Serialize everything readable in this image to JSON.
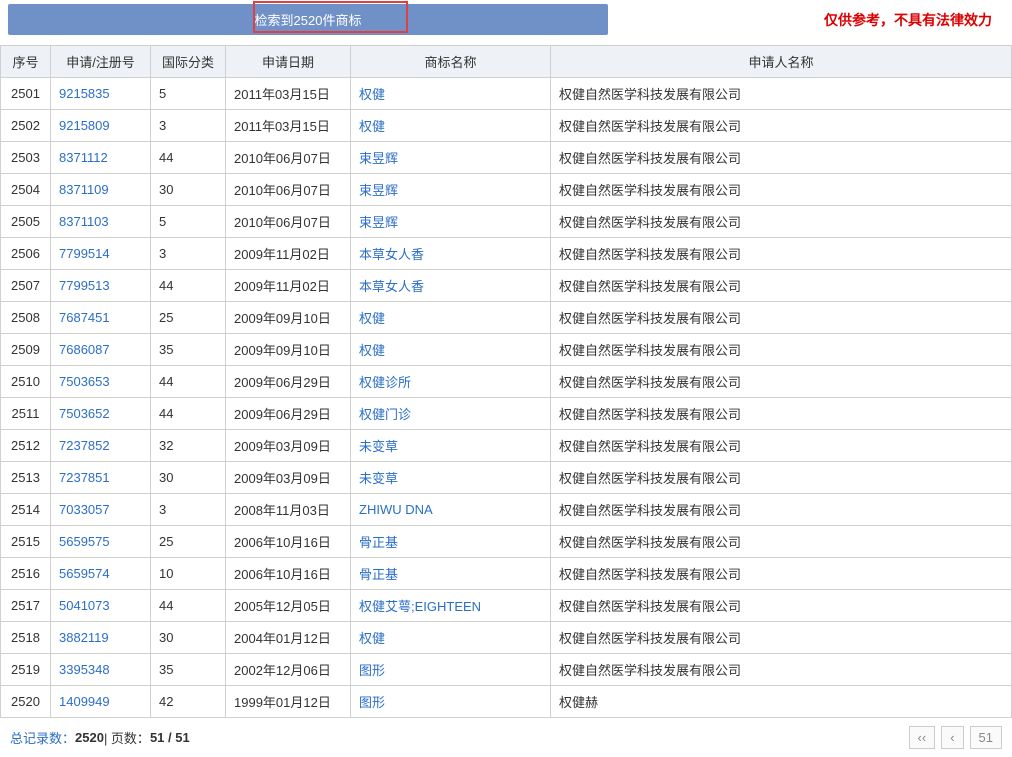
{
  "header": {
    "title": "检索到2520件商标",
    "disclaimer": "仅供参考，不具有法律效力"
  },
  "columns": [
    "序号",
    "申请/注册号",
    "国际分类",
    "申请日期",
    "商标名称",
    "申请人名称"
  ],
  "rows": [
    {
      "seq": "2501",
      "regno": "9215835",
      "cls": "5",
      "date": "2011年03月15日",
      "name": "权健",
      "applicant": "权健自然医学科技发展有限公司"
    },
    {
      "seq": "2502",
      "regno": "9215809",
      "cls": "3",
      "date": "2011年03月15日",
      "name": "权健",
      "applicant": "权健自然医学科技发展有限公司"
    },
    {
      "seq": "2503",
      "regno": "8371112",
      "cls": "44",
      "date": "2010年06月07日",
      "name": "束昱辉",
      "applicant": "权健自然医学科技发展有限公司"
    },
    {
      "seq": "2504",
      "regno": "8371109",
      "cls": "30",
      "date": "2010年06月07日",
      "name": "束昱辉",
      "applicant": "权健自然医学科技发展有限公司"
    },
    {
      "seq": "2505",
      "regno": "8371103",
      "cls": "5",
      "date": "2010年06月07日",
      "name": "束昱辉",
      "applicant": "权健自然医学科技发展有限公司"
    },
    {
      "seq": "2506",
      "regno": "7799514",
      "cls": "3",
      "date": "2009年11月02日",
      "name": "本草女人香",
      "applicant": "权健自然医学科技发展有限公司"
    },
    {
      "seq": "2507",
      "regno": "7799513",
      "cls": "44",
      "date": "2009年11月02日",
      "name": "本草女人香",
      "applicant": "权健自然医学科技发展有限公司"
    },
    {
      "seq": "2508",
      "regno": "7687451",
      "cls": "25",
      "date": "2009年09月10日",
      "name": "权健",
      "applicant": "权健自然医学科技发展有限公司"
    },
    {
      "seq": "2509",
      "regno": "7686087",
      "cls": "35",
      "date": "2009年09月10日",
      "name": "权健",
      "applicant": "权健自然医学科技发展有限公司"
    },
    {
      "seq": "2510",
      "regno": "7503653",
      "cls": "44",
      "date": "2009年06月29日",
      "name": "权健诊所",
      "applicant": "权健自然医学科技发展有限公司"
    },
    {
      "seq": "2511",
      "regno": "7503652",
      "cls": "44",
      "date": "2009年06月29日",
      "name": "权健门诊",
      "applicant": "权健自然医学科技发展有限公司"
    },
    {
      "seq": "2512",
      "regno": "7237852",
      "cls": "32",
      "date": "2009年03月09日",
      "name": "未变草",
      "applicant": "权健自然医学科技发展有限公司"
    },
    {
      "seq": "2513",
      "regno": "7237851",
      "cls": "30",
      "date": "2009年03月09日",
      "name": "未变草",
      "applicant": "权健自然医学科技发展有限公司"
    },
    {
      "seq": "2514",
      "regno": "7033057",
      "cls": "3",
      "date": "2008年11月03日",
      "name": "ZHIWU DNA",
      "applicant": "权健自然医学科技发展有限公司"
    },
    {
      "seq": "2515",
      "regno": "5659575",
      "cls": "25",
      "date": "2006年10月16日",
      "name": "骨正基",
      "applicant": "权健自然医学科技发展有限公司"
    },
    {
      "seq": "2516",
      "regno": "5659574",
      "cls": "10",
      "date": "2006年10月16日",
      "name": "骨正基",
      "applicant": "权健自然医学科技发展有限公司"
    },
    {
      "seq": "2517",
      "regno": "5041073",
      "cls": "44",
      "date": "2005年12月05日",
      "name": "权健艾萼;EIGHTEEN",
      "applicant": "权健自然医学科技发展有限公司"
    },
    {
      "seq": "2518",
      "regno": "3882119",
      "cls": "30",
      "date": "2004年01月12日",
      "name": "权健",
      "applicant": "权健自然医学科技发展有限公司"
    },
    {
      "seq": "2519",
      "regno": "3395348",
      "cls": "35",
      "date": "2002年12月06日",
      "name": "图形",
      "applicant": "权健自然医学科技发展有限公司"
    },
    {
      "seq": "2520",
      "regno": "1409949",
      "cls": "42",
      "date": "1999年01月12日",
      "name": "图形",
      "applicant": "权健赫"
    }
  ],
  "footer": {
    "total_label": "总记录数：",
    "total": "2520",
    "page_sep": " | 页数：",
    "page": "51 / 51",
    "pager_prev": "‹‹",
    "pager_prev1": "‹",
    "pager_last": "51"
  }
}
